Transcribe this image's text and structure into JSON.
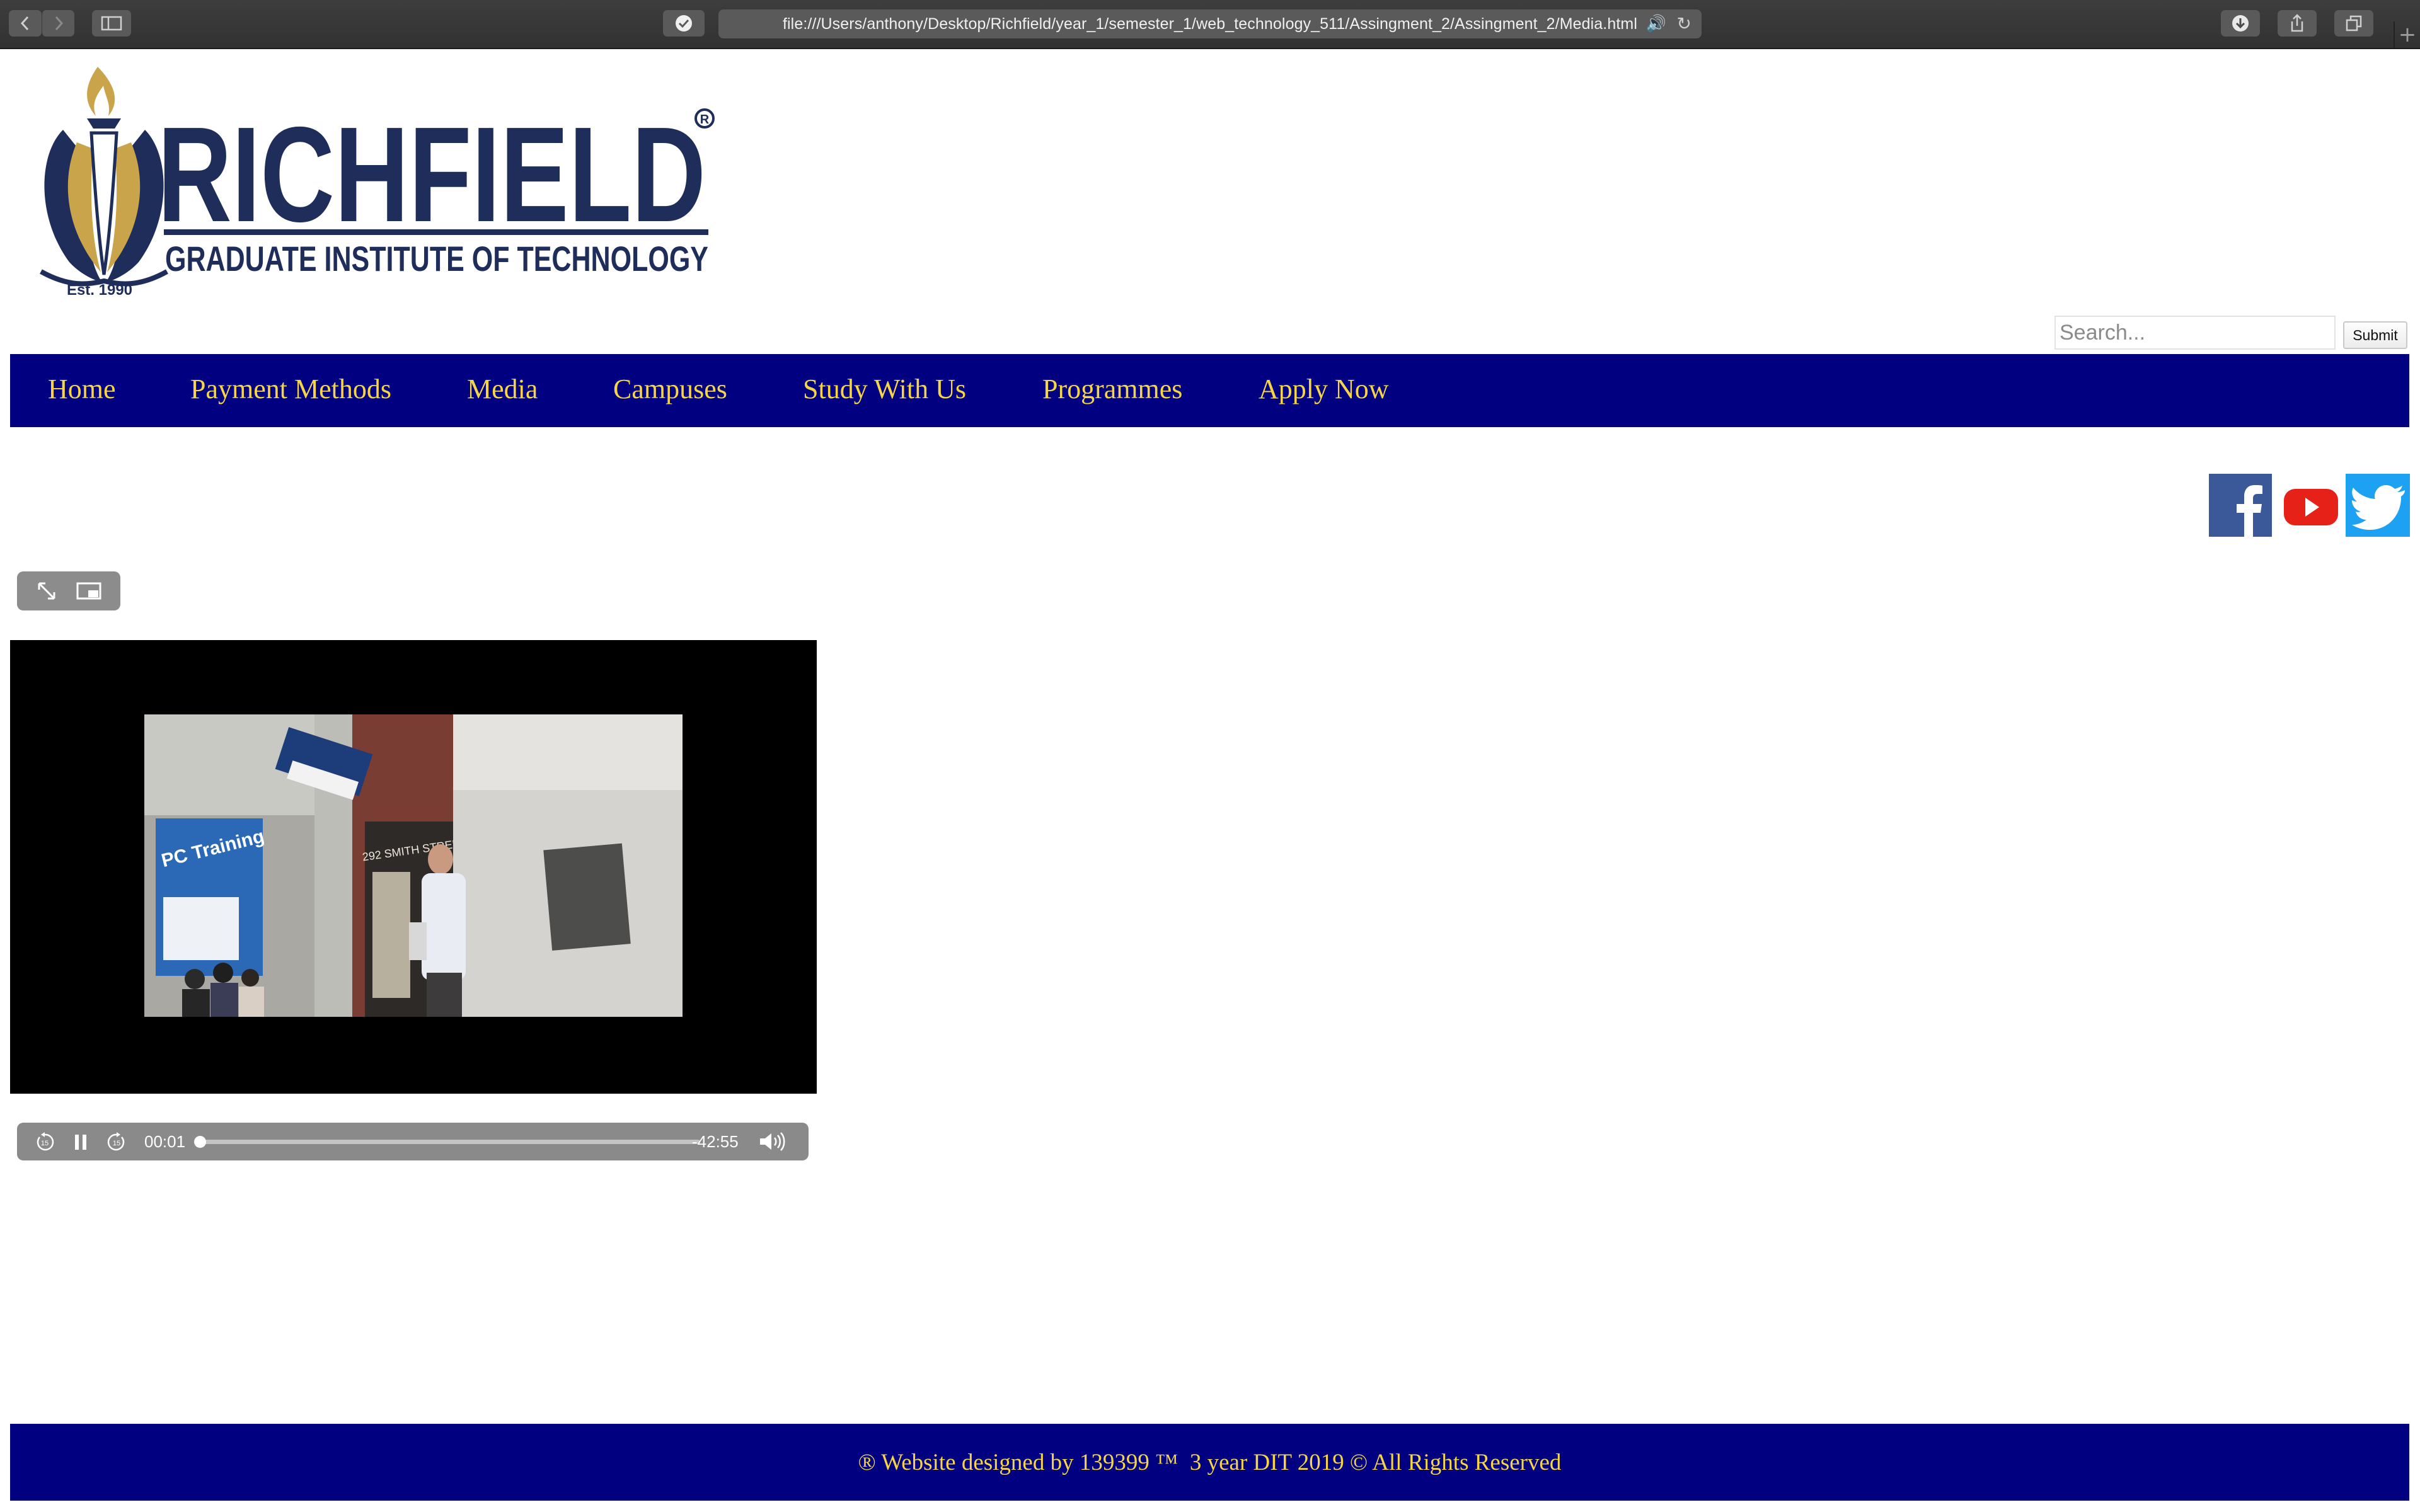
{
  "browser": {
    "url": "file:///Users/anthony/Desktop/Richfield/year_1/semester_1/web_technology_511/Assingment_2/Assingment_2/Media.html",
    "back_icon": "chevron-left-icon",
    "forward_icon": "chevron-right-icon",
    "sidebar_icon": "sidebar-icon",
    "shield_icon": "shield-check-icon",
    "audio_icon": "speaker-icon",
    "reload_icon": "reload-icon",
    "download_icon": "download-icon",
    "share_icon": "share-icon",
    "tabs_icon": "tabs-icon",
    "new_tab_label": "+"
  },
  "logo": {
    "name": "RICHFIELD",
    "tagline": "GRADUATE INSTITUTE OF TECHNOLOGY",
    "established": "Est. 1990",
    "registered_mark": "R",
    "colors": {
      "navy": "#1f2d5a",
      "gold": "#c9a44a"
    }
  },
  "search": {
    "placeholder": "Search...",
    "value": "",
    "submit_label": "Submit"
  },
  "nav": {
    "items": [
      {
        "label": "Home"
      },
      {
        "label": "Payment Methods"
      },
      {
        "label": "Media"
      },
      {
        "label": "Campuses"
      },
      {
        "label": "Study With Us"
      },
      {
        "label": "Programmes"
      },
      {
        "label": "Apply Now"
      }
    ],
    "background": "#000080",
    "text_color": "#f5d547"
  },
  "social": {
    "facebook": {
      "icon": "facebook-icon",
      "color": "#3b5998"
    },
    "youtube": {
      "icon": "youtube-icon",
      "color": "#e62117"
    },
    "twitter": {
      "icon": "twitter-icon",
      "color": "#1da1f2"
    }
  },
  "video": {
    "top_controls": {
      "fullscreen_icon": "fullscreen-icon",
      "pip_icon": "picture-in-picture-icon"
    },
    "scene": {
      "sign_text": "PC Training",
      "street_text": "292 SMITH STREET"
    },
    "controls": {
      "skip_back_icon": "skip-back-15-icon",
      "pause_icon": "pause-icon",
      "skip_forward_icon": "skip-forward-15-icon",
      "volume_icon": "volume-icon",
      "current_time": "00:01",
      "remaining_time": "-42:55",
      "progress_fraction": 0.0004
    }
  },
  "footer": {
    "text": "® Website designed by 139399 ™  3 year DIT 2019 © All Rights Reserved"
  }
}
